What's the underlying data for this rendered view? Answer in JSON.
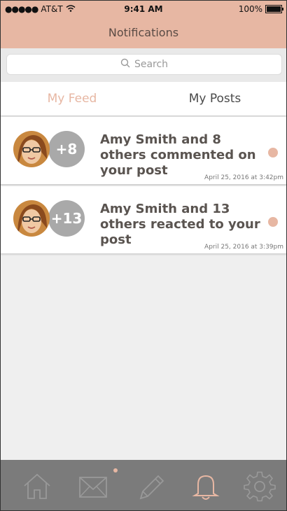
{
  "status_bar": {
    "carrier": "AT&T",
    "time": "9:41 AM",
    "battery": "100%"
  },
  "nav": {
    "title": "Notifications"
  },
  "search": {
    "placeholder": "Search"
  },
  "tabs": [
    {
      "label": "My Feed",
      "active": true
    },
    {
      "label": "My Posts",
      "active": false
    }
  ],
  "notifications": [
    {
      "count_label": "+8",
      "message": "Amy Smith and 8 others commented on your post",
      "timestamp": "April 25, 2016 at 3:42pm",
      "unread": true
    },
    {
      "count_label": "+13",
      "message": "Amy Smith and 13 others reacted to your post",
      "timestamp": "April 25, 2016 at 3:39pm",
      "unread": true
    }
  ],
  "bottom_tabs": [
    {
      "icon": "home-icon",
      "active": false
    },
    {
      "icon": "mail-icon",
      "active": false,
      "badge": true
    },
    {
      "icon": "pencil-icon",
      "active": false
    },
    {
      "icon": "bell-icon",
      "active": true
    },
    {
      "icon": "gear-icon",
      "active": false
    }
  ],
  "colors": {
    "accent": "#e7b7a3",
    "tabbar_bg": "#7b7b7b",
    "count_bubble": "#a9a9a9",
    "text_dark": "#5a5450"
  }
}
